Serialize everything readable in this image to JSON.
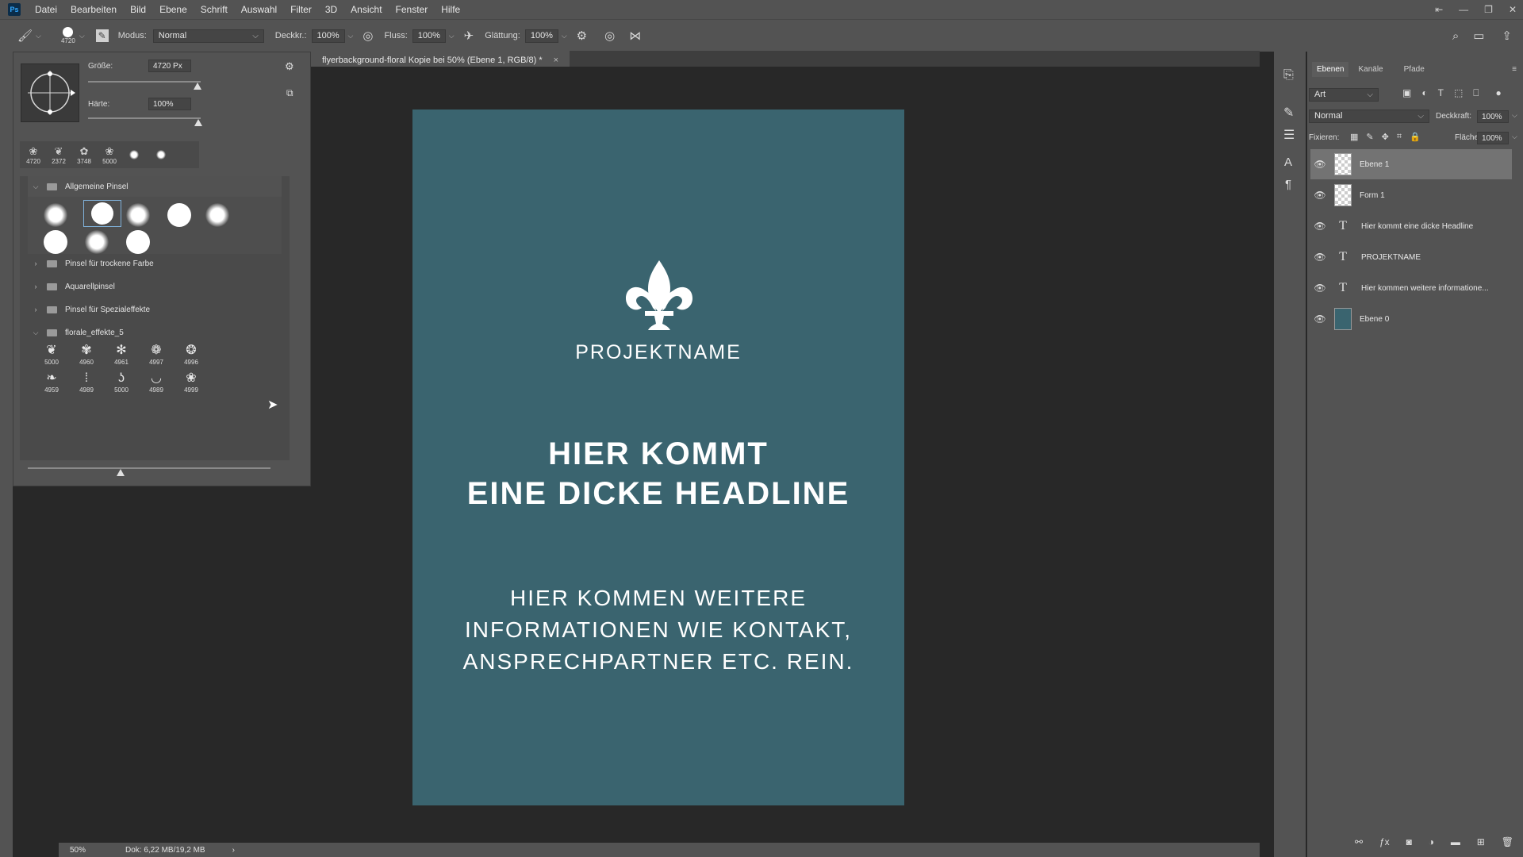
{
  "menu": [
    "Datei",
    "Bearbeiten",
    "Bild",
    "Ebene",
    "Schrift",
    "Auswahl",
    "Filter",
    "3D",
    "Ansicht",
    "Fenster",
    "Hilfe"
  ],
  "app_logo": "Ps",
  "window_controls": [
    "⇤",
    "—",
    "❐",
    "✕"
  ],
  "options": {
    "brush_size": "4720",
    "modus_label": "Modus:",
    "modus_value": "Normal",
    "deckkr_label": "Deckkr.:",
    "deckkr_value": "100%",
    "fluss_label": "Fluss:",
    "fluss_value": "100%",
    "glaettung_label": "Glättung:",
    "glaettung_value": "100%"
  },
  "brush_panel": {
    "groesse_label": "Größe:",
    "groesse_value": "4720 Px",
    "haerte_label": "Härte:",
    "haerte_value": "100%",
    "recent": [
      "4720",
      "2372",
      "3748",
      "5000"
    ],
    "groups": {
      "allgemeine": "Allgemeine Pinsel",
      "trockene": "Pinsel für trockene Farbe",
      "aquarell": "Aquarellpinsel",
      "spezial": "Pinsel für Spezialeffekte",
      "florale": "florale_effekte_5"
    },
    "florale_sizes": [
      "5000",
      "4960",
      "4961",
      "4997",
      "4996",
      "4959",
      "4989",
      "5000",
      "4989",
      "4999"
    ]
  },
  "document": {
    "tab_title": "flyerbackground-floral Kopie bei 50% (Ebene 1, RGB/8) *",
    "tab_close": "×",
    "flyer_color": "#3a646f",
    "projektname": "PROJEKTNAME",
    "headline_1": "HIER KOMMT",
    "headline_2": "EINE DICKE HEADLINE",
    "info_1": "HIER KOMMEN WEITERE",
    "info_2": "INFORMATIONEN WIE KONTAKT,",
    "info_3": "ANSPRECHPARTNER ETC. REIN."
  },
  "status": {
    "zoom": "50%",
    "doc": "Dok: 6,22 MB/19,2 MB",
    "arrow": "›"
  },
  "layers_panel": {
    "tabs": [
      "Ebenen",
      "Kanäle",
      "Pfade"
    ],
    "filter_label": "Art",
    "blend_mode": "Normal",
    "deckkraft_label": "Deckkraft:",
    "deckkraft_value": "100%",
    "fixieren_label": "Fixieren:",
    "flaeche_label": "Fläche:",
    "flaeche_value": "100%",
    "layers": [
      {
        "name": "Ebene 1",
        "kind": "pixel",
        "selected": true
      },
      {
        "name": "Form 1",
        "kind": "shape",
        "selected": false
      },
      {
        "name": "Hier kommt  eine dicke Headline",
        "kind": "text",
        "selected": false
      },
      {
        "name": "PROJEKTNAME",
        "kind": "text",
        "selected": false
      },
      {
        "name": "Hier kommen weitere informatione...",
        "kind": "text",
        "selected": false
      },
      {
        "name": "Ebene 0",
        "kind": "fill",
        "selected": false
      }
    ]
  }
}
